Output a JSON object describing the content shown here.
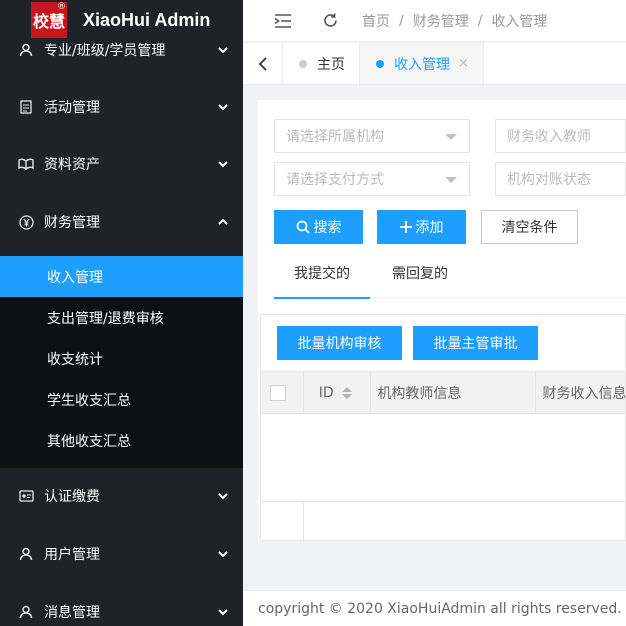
{
  "app": {
    "logo_text": "校慧",
    "logo_mark": "®",
    "title": "XiaoHui Admin"
  },
  "sidebar": {
    "items": [
      {
        "label": "专业/班级/学员管理",
        "icon": "user-icon",
        "expanded": false
      },
      {
        "label": "活动管理",
        "icon": "document-icon",
        "expanded": false
      },
      {
        "label": "资料资产",
        "icon": "book-icon",
        "expanded": false
      },
      {
        "label": "财务管理",
        "icon": "yen-circle-icon",
        "expanded": true
      },
      {
        "label": "认证缴费",
        "icon": "card-icon",
        "expanded": false
      },
      {
        "label": "用户管理",
        "icon": "user-icon",
        "expanded": false
      },
      {
        "label": "消息管理",
        "icon": "user-icon",
        "expanded": false
      }
    ],
    "finance_sub": [
      {
        "label": "收入管理",
        "active": true
      },
      {
        "label": "支出管理/退费审核",
        "active": false
      },
      {
        "label": "收支统计",
        "active": false
      },
      {
        "label": "学生收支汇总",
        "active": false
      },
      {
        "label": "其他收支汇总",
        "active": false
      }
    ]
  },
  "topbar": {
    "breadcrumb": [
      "首页",
      "财务管理",
      "收入管理"
    ],
    "separator": "/"
  },
  "tabs": [
    {
      "label": "主页",
      "active": false
    },
    {
      "label": "收入管理",
      "active": true,
      "close": "×"
    }
  ],
  "filters": {
    "institution_placeholder": "请选择所属机构",
    "teacher_placeholder": "财务收入教师",
    "payment_placeholder": "请选择支付方式",
    "reconcile_placeholder": "机构对账状态"
  },
  "actions": {
    "search": "搜索",
    "add": "添加",
    "clear": "清空条件"
  },
  "subtabs": [
    "我提交的",
    "需回复的"
  ],
  "table": {
    "batch_institution": "批量机构审核",
    "batch_supervisor": "批量主管审批",
    "columns": [
      "ID",
      "机构教师信息",
      "财务收入信息"
    ]
  },
  "footer": {
    "copyright": "copyright © 2020 XiaoHuiAdmin all rights reserved."
  },
  "colors": {
    "sidebar_bg": "#20222a",
    "submenu_bg": "#0f1014",
    "accent": "#1e9fff",
    "brand_red": "#c9151e"
  }
}
